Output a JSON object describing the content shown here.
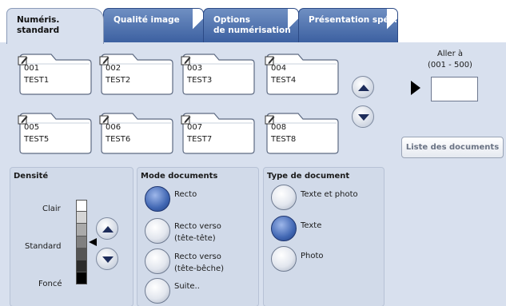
{
  "tabs": [
    {
      "label": "Numéris. standard",
      "label2": ""
    },
    {
      "label": "Qualité image",
      "label2": ""
    },
    {
      "label": "Options",
      "label2": "de numérisation"
    },
    {
      "label": "Présentation spéc.",
      "label2": ""
    }
  ],
  "folders": [
    {
      "number": "001",
      "name": "TEST1"
    },
    {
      "number": "002",
      "name": "TEST2"
    },
    {
      "number": "003",
      "name": "TEST3"
    },
    {
      "number": "004",
      "name": "TEST4"
    },
    {
      "number": "005",
      "name": "TEST5"
    },
    {
      "number": "006",
      "name": "TEST6"
    },
    {
      "number": "007",
      "name": "TEST7"
    },
    {
      "number": "008",
      "name": "TEST8"
    }
  ],
  "goto": {
    "label": "Aller à",
    "range": "(001 - 500)",
    "value": ""
  },
  "document_list_label": "Liste des documents",
  "density": {
    "title": "Densité",
    "light_label": "Clair",
    "standard_label": "Standard",
    "dark_label": "Foncé",
    "levels": 7,
    "selected_level": 4
  },
  "document_mode": {
    "title": "Mode documents",
    "options": [
      {
        "label": "Recto",
        "label2": "",
        "selected": true
      },
      {
        "label": "Recto verso",
        "label2": "(tête-tête)",
        "selected": false
      },
      {
        "label": "Recto verso",
        "label2": "(tête-bêche)",
        "selected": false
      },
      {
        "label": "Suite..",
        "label2": "",
        "selected": false
      }
    ]
  },
  "document_type": {
    "title": "Type de document",
    "options": [
      {
        "label": "Texte et photo",
        "selected": false
      },
      {
        "label": "Texte",
        "selected": true
      },
      {
        "label": "Photo",
        "selected": false
      }
    ]
  },
  "colors": {
    "panel": "#d8e0ee",
    "tab": "#4a6aaa",
    "selected_radio": "#4167b3"
  }
}
